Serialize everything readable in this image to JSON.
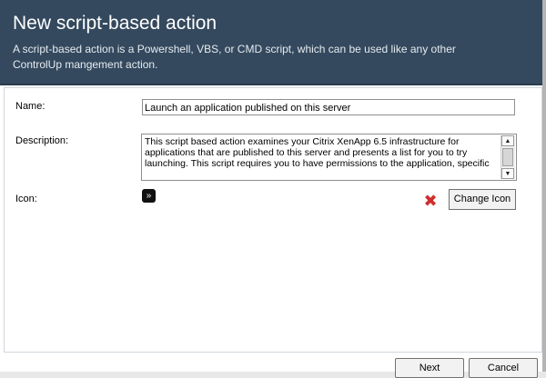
{
  "dialog": {
    "title": "New script-based action",
    "subtitle": "A script-based action is a Powershell, VBS, or CMD script, which can be used like any other ControlUp mangement action."
  },
  "form": {
    "name_label": "Name:",
    "name_value": "Launch an application published on this server",
    "description_label": "Description:",
    "description_value": "This script based action examines your Citrix XenApp 6.5 infrastructure for applications that are published to this server and presents a list for you to try launching.  This script requires you to have permissions to the application, specific",
    "icon_label": "Icon:",
    "icon_symbol": "»",
    "remove_symbol": "✖",
    "change_icon_label": "Change Icon",
    "scroll_up": "▲",
    "scroll_down": "▼"
  },
  "footer": {
    "next_label": "Next",
    "cancel_label": "Cancel"
  },
  "colors": {
    "header_bg": "#34495e",
    "remove_icon": "#d12c2c"
  }
}
